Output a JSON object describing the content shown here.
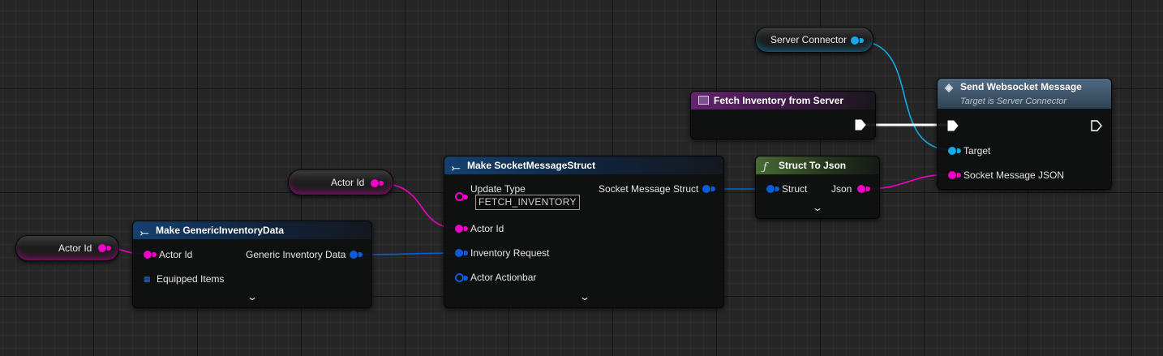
{
  "variables": {
    "actor_id_left": "Actor Id",
    "actor_id_top": "Actor Id",
    "server_connector": "Server Connector"
  },
  "make_generic_inventory": {
    "title": "Make GenericInventoryData",
    "inputs": [
      "Actor Id",
      "Equipped Items"
    ],
    "output": "Generic Inventory Data"
  },
  "make_socket_message": {
    "title": "Make SocketMessageStruct",
    "inputs": [
      "Update Type",
      "Actor Id",
      "Inventory Request",
      "Actor Actionbar"
    ],
    "update_type_value": "FETCH_INVENTORY",
    "output": "Socket Message Struct"
  },
  "struct_to_json": {
    "title": "Struct To Json",
    "input": "Struct",
    "output": "Json"
  },
  "fetch_event": {
    "title": "Fetch Inventory from Server"
  },
  "send_websocket": {
    "title": "Send Websocket Message",
    "subtitle": "Target is Server Connector",
    "inputs": [
      "Target",
      "Socket Message JSON"
    ]
  },
  "colors": {
    "string_pin": "#f200c8",
    "struct_pin": "#0a5cd8",
    "object_pin": "#17a8e8",
    "exec_pin": "#ffffff"
  },
  "icons": {
    "make_struct": "make-struct-icon",
    "function": "function-icon",
    "event": "event-icon",
    "message": "message-function-icon",
    "expand": "chevron-down-icon"
  }
}
